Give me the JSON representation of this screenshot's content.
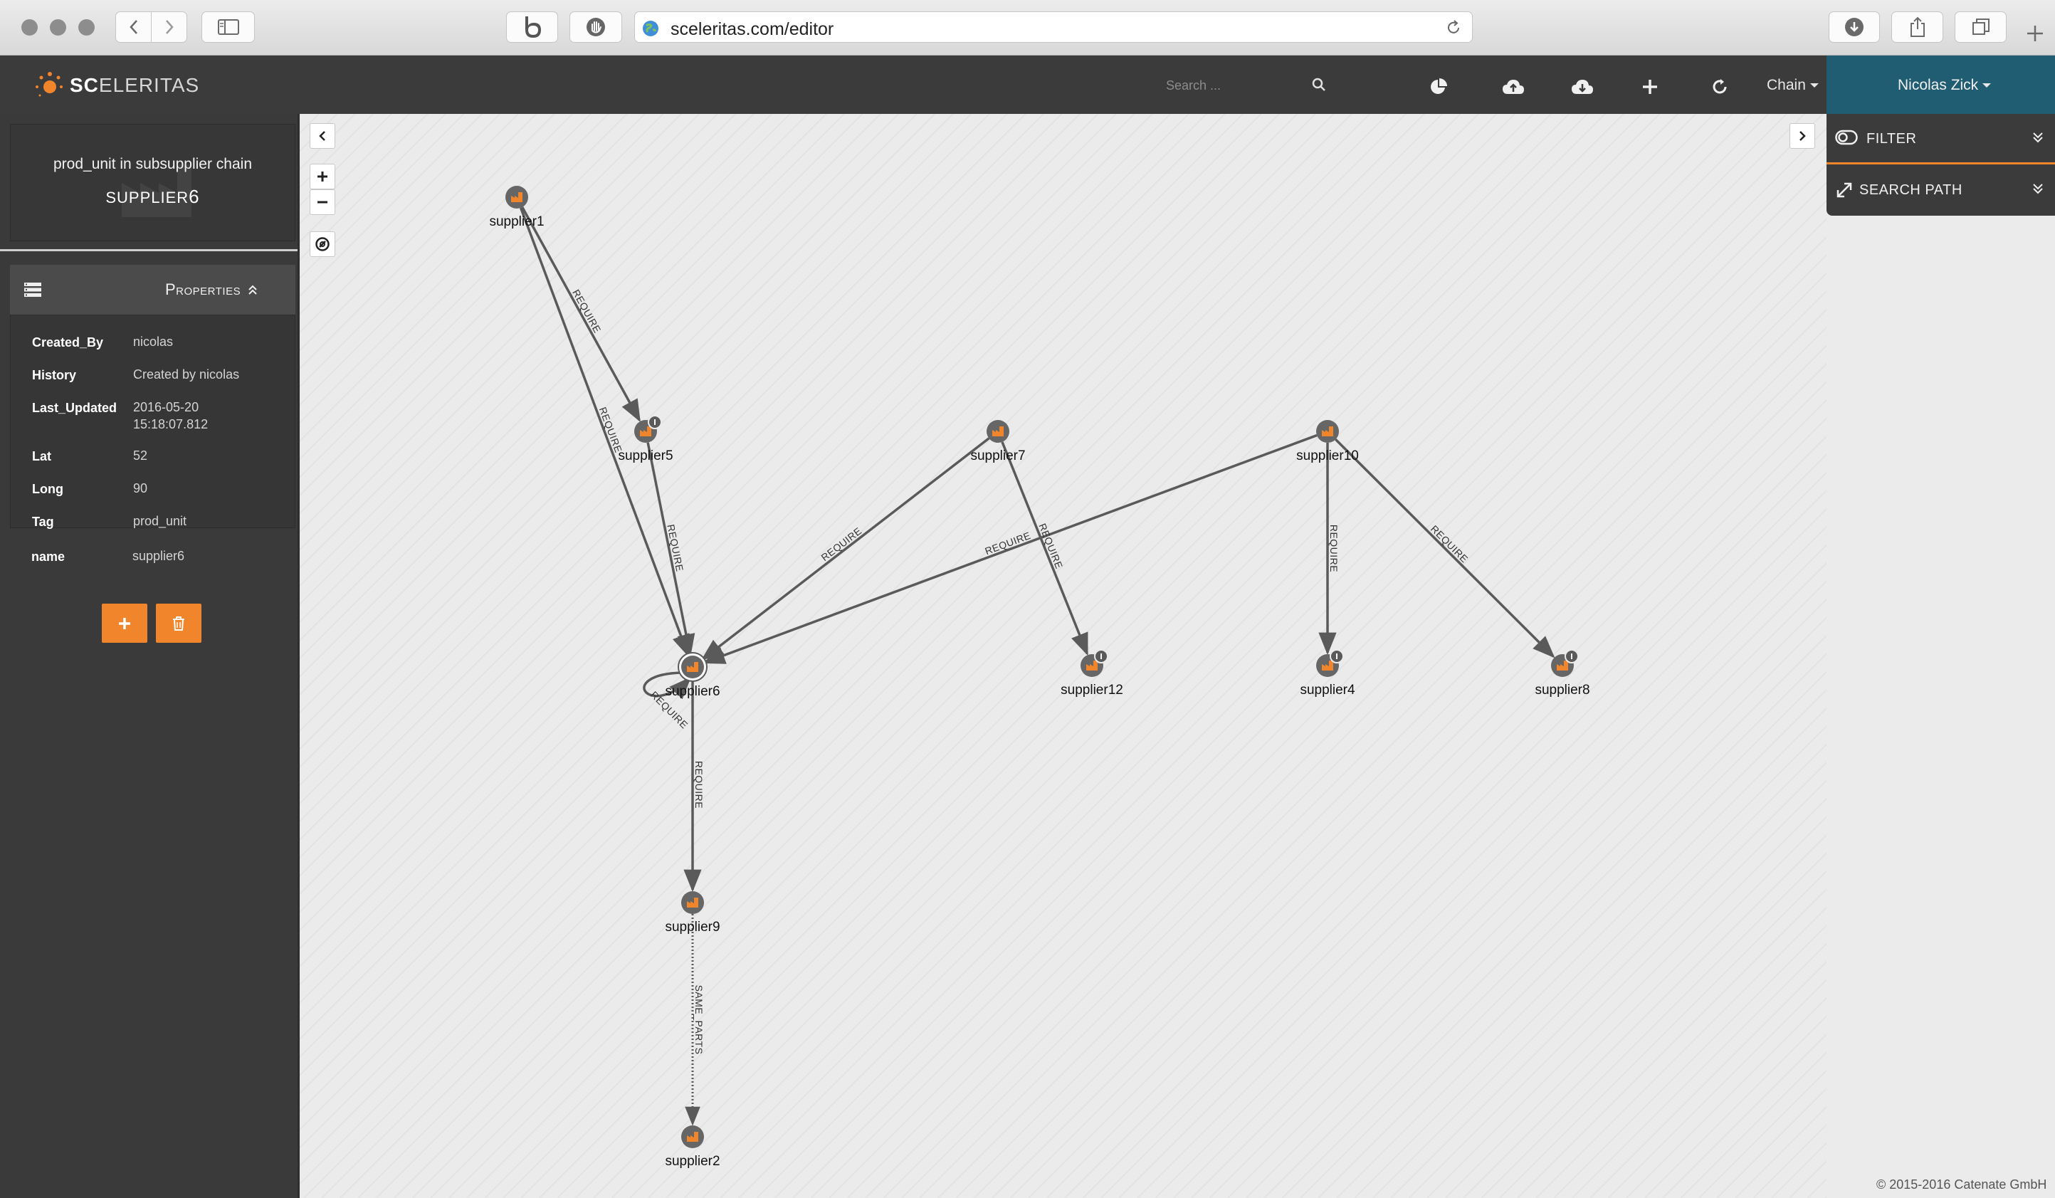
{
  "browser": {
    "url": "sceleritas.com/editor"
  },
  "app": {
    "logo_bold": "SC",
    "logo_rest": "ELERITAS",
    "search_placeholder": "Search ...",
    "chain_label": "Chain",
    "user_name": "Nicolas Zick",
    "accent_color": "#f1852b",
    "user_color": "#215d72"
  },
  "sidebar": {
    "card_subtitle": "prod_unit in subsupplier chain",
    "card_title_prefix": "SUPPLIER",
    "card_title_suffix": "6",
    "properties_title": "Properties",
    "properties": [
      {
        "key": "Created_By",
        "value": "nicolas"
      },
      {
        "key": "History",
        "value": "Created by nicolas"
      },
      {
        "key": "Last_Updated",
        "value": "2016-05-20 15:18:07.812"
      },
      {
        "key": "Lat",
        "value": "52"
      },
      {
        "key": "Long",
        "value": "90"
      },
      {
        "key": "Tag",
        "value": "prod_unit"
      },
      {
        "key": "name",
        "value": "supplier6"
      }
    ]
  },
  "right_panel": {
    "filter_label": "FILTER",
    "search_path_label": "SEARCH PATH"
  },
  "graph": {
    "nodes": [
      {
        "id": "supplier1",
        "label": "supplier1",
        "badge": false
      },
      {
        "id": "supplier5",
        "label": "supplier5",
        "badge": true
      },
      {
        "id": "supplier7",
        "label": "supplier7",
        "badge": false
      },
      {
        "id": "supplier10",
        "label": "supplier10",
        "badge": false
      },
      {
        "id": "supplier6",
        "label": "supplier6",
        "badge": false
      },
      {
        "id": "supplier12",
        "label": "supplier12",
        "badge": true
      },
      {
        "id": "supplier4",
        "label": "supplier4",
        "badge": true
      },
      {
        "id": "supplier8",
        "label": "supplier8",
        "badge": true
      },
      {
        "id": "supplier9",
        "label": "supplier9",
        "badge": false
      },
      {
        "id": "supplier2",
        "label": "supplier2",
        "badge": false
      }
    ],
    "edges": [
      {
        "from": "supplier1",
        "to": "supplier5",
        "label": "REQUIRE",
        "style": "solid"
      },
      {
        "from": "supplier1",
        "to": "supplier6",
        "label": "REQUIRE",
        "style": "solid"
      },
      {
        "from": "supplier5",
        "to": "supplier6",
        "label": "REQUIRE",
        "style": "solid"
      },
      {
        "from": "supplier7",
        "to": "supplier6",
        "label": "REQUIRE",
        "style": "solid"
      },
      {
        "from": "supplier10",
        "to": "supplier6",
        "label": "REQUIRE",
        "style": "solid"
      },
      {
        "from": "supplier7",
        "to": "supplier12",
        "label": "REQUIRE",
        "style": "solid"
      },
      {
        "from": "supplier10",
        "to": "supplier4",
        "label": "REQUIRE",
        "style": "solid"
      },
      {
        "from": "supplier10",
        "to": "supplier8",
        "label": "REQUIRE",
        "style": "solid"
      },
      {
        "from": "supplier6",
        "to": "supplier6",
        "label": "REQUIRE",
        "style": "solid"
      },
      {
        "from": "supplier6",
        "to": "supplier9",
        "label": "REQUIRE",
        "style": "solid"
      },
      {
        "from": "supplier9",
        "to": "supplier2",
        "label": "SAME_PARTS",
        "style": "dotted"
      }
    ]
  },
  "footer": {
    "copyright": "© 2015-2016 Catenate GmbH"
  }
}
